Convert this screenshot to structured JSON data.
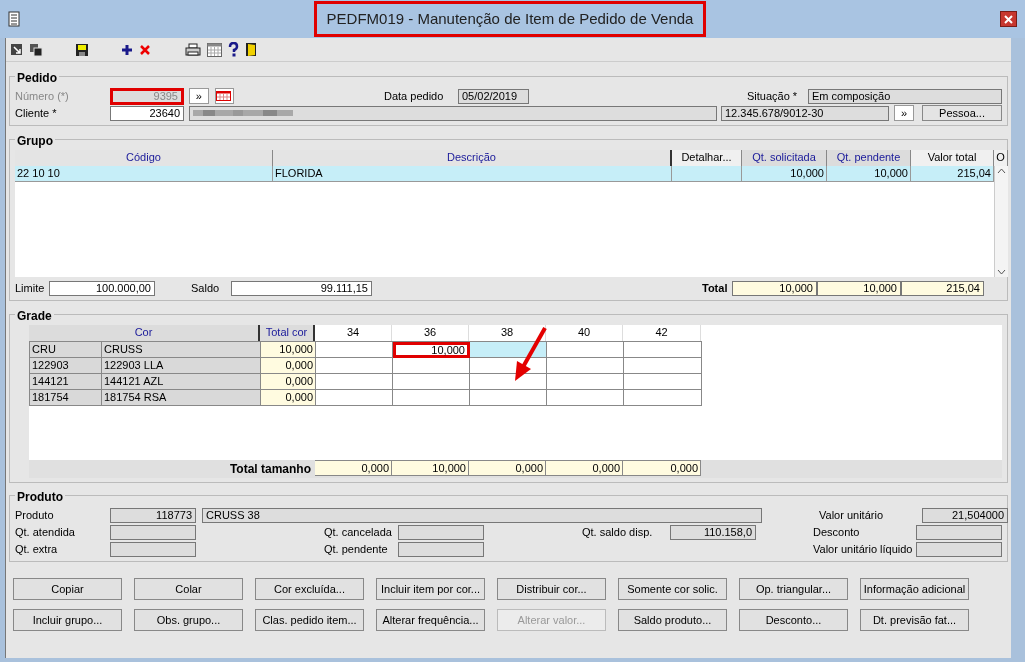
{
  "window": {
    "title": "PEDFM019 - Manutenção de Item de Pedido de Venda",
    "title_highlighted": true
  },
  "pedido": {
    "legend": "Pedido",
    "numero_label": "Número (*)",
    "numero": "9395",
    "numero_highlighted": true,
    "numero_disabled": true,
    "numero_next": "»",
    "data_label": "Data pedido",
    "data": "05/02/2019",
    "situacao_label": "Situação *",
    "situacao": "Em composição",
    "cliente_label": "Cliente *",
    "cliente": "23640",
    "documento": "12.345.678/9012-30",
    "documento_next": "»",
    "pessoa_button": "Pessoa..."
  },
  "grupo": {
    "legend": "Grupo",
    "columns": [
      {
        "label": "Código",
        "kind": "plain"
      },
      {
        "label": "Descrição",
        "kind": "plain"
      },
      {
        "label": "Detalhar...",
        "kind": "button"
      },
      {
        "label": "Qt. solicitada",
        "kind": "sortable"
      },
      {
        "label": "Qt. pendente",
        "kind": "sortable"
      },
      {
        "label": "Valor total",
        "kind": "button"
      },
      {
        "label": "O",
        "kind": "button"
      }
    ],
    "rows": [
      {
        "cells": [
          "22 10 10",
          "FLORIDA",
          null,
          "10,000",
          "10,000",
          "215,04"
        ],
        "selected": true
      }
    ],
    "limite_label": "Limite",
    "limite": "100.000,00",
    "saldo_label": "Saldo",
    "saldo": "99.111,15",
    "total_label": "Total",
    "totals": [
      "10,000",
      "10,000",
      "215,04"
    ]
  },
  "grade": {
    "legend": "Grade",
    "cor_header": "Cor",
    "total_cor_header": "Total cor",
    "sizes": [
      "34",
      "36",
      "38",
      "40",
      "42"
    ],
    "rows": [
      {
        "code": "CRU",
        "name": "CRUSS",
        "total": "10,000",
        "cells": [
          {
            "selected": false,
            "highlighted": false
          },
          {
            "value": "10,000",
            "selected": false,
            "highlighted": true
          },
          {
            "selected": true,
            "highlighted": false
          },
          {
            "selected": false,
            "highlighted": false
          },
          {
            "selected": false,
            "highlighted": false
          }
        ]
      },
      {
        "code": "122903",
        "name": "122903 LLA",
        "total": "0,000",
        "cells": [
          {
            "selected": false,
            "highlighted": false
          },
          {
            "selected": false,
            "highlighted": false
          },
          {
            "selected": false,
            "highlighted": false
          },
          {
            "selected": false,
            "highlighted": false
          },
          {
            "selected": false,
            "highlighted": false
          }
        ]
      },
      {
        "code": "144121",
        "name": "144121 AZL",
        "total": "0,000",
        "cells": [
          {
            "selected": false,
            "highlighted": false
          },
          {
            "selected": false,
            "highlighted": false
          },
          {
            "selected": false,
            "highlighted": false
          },
          {
            "selected": false,
            "highlighted": false
          },
          {
            "selected": false,
            "highlighted": false
          }
        ]
      },
      {
        "code": "181754",
        "name": "181754 RSA",
        "total": "0,000",
        "cells": [
          {
            "selected": false,
            "highlighted": false
          },
          {
            "selected": false,
            "highlighted": false
          },
          {
            "selected": false,
            "highlighted": false
          },
          {
            "selected": false,
            "highlighted": false
          },
          {
            "selected": false,
            "highlighted": false
          }
        ]
      }
    ],
    "total_label": "Total tamanho",
    "totals": [
      "0,000",
      "10,000",
      "0,000",
      "0,000",
      "0,000"
    ]
  },
  "produto": {
    "legend": "Produto",
    "produto_label": "Produto",
    "produto_code": "118773",
    "produto_name": "CRUSS 38",
    "atendida_label": "Qt. atendida",
    "extra_label": "Qt. extra",
    "cancelada_label": "Qt. cancelada",
    "pendente_label": "Qt. pendente",
    "saldo_label": "Qt. saldo disp.",
    "saldo": "110.158,0",
    "unitario_label": "Valor unitário",
    "unitario": "21,504000",
    "desconto_label": "Desconto",
    "liquido_label": "Valor unitário líquido"
  },
  "buttons": [
    [
      {
        "label": "Copiar",
        "disabled": false
      },
      {
        "label": "Colar",
        "disabled": false
      },
      {
        "label": "Cor excluída...",
        "disabled": false
      },
      {
        "label": "Incluir item por cor...",
        "disabled": false
      },
      {
        "label": "Distribuir cor...",
        "disabled": false
      },
      {
        "label": "Somente cor solic.",
        "disabled": false
      },
      {
        "label": "Op. triangular...",
        "disabled": false
      },
      {
        "label": "Informação adicional",
        "disabled": false
      }
    ],
    [
      {
        "label": "Incluir grupo...",
        "disabled": false
      },
      {
        "label": "Obs. grupo...",
        "disabled": false
      },
      {
        "label": "Clas. pedido item...",
        "disabled": false
      },
      {
        "label": "Alterar frequência...",
        "disabled": false
      },
      {
        "label": "Alterar valor...",
        "disabled": true
      },
      {
        "label": "Saldo produto...",
        "disabled": false
      },
      {
        "label": "Desconto...",
        "disabled": false
      },
      {
        "label": "Dt. previsão fat...",
        "disabled": false
      }
    ]
  ]
}
